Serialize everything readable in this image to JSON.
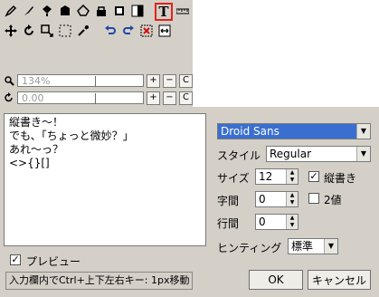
{
  "toolbar": {
    "icons_row1": [
      "pen-icon",
      "brush-icon",
      "fill-icon",
      "shape-icon",
      "polygon-icon",
      "lock-icon",
      "select-icon",
      "contrast-icon",
      "text-tool-icon",
      "ruler-icon"
    ],
    "icons_row2": [
      "move-icon",
      "rotate-icon",
      "resize-icon",
      "marquee-icon",
      "eyedropper-icon",
      "undo-icon",
      "redo-icon",
      "delete-icon",
      "flip-icon"
    ],
    "text_tool_glyph": "T"
  },
  "zoom": {
    "scale_value": "134%",
    "rotation_value": "0.00",
    "plus": "+",
    "minus": "−",
    "reset": "C"
  },
  "text_input": {
    "lines": [
      "縦書き～！",
      "でも、「ちょっと微妙？」",
      "あれ～っ？",
      "<>{}[]"
    ]
  },
  "font": {
    "family": "Droid Sans",
    "style_label": "スタイル",
    "style_value": "Regular",
    "size_label": "サイズ",
    "size_value": "12",
    "vertical_label": "縦書き",
    "vertical_checked": true,
    "letter_spacing_label": "字間",
    "letter_spacing_value": "0",
    "binary_label": "2値",
    "binary_checked": false,
    "line_spacing_label": "行間",
    "line_spacing_value": "0",
    "hinting_label": "ヒンティング",
    "hinting_value": "標準"
  },
  "preview": {
    "label": "プレビュー",
    "checked": true
  },
  "status_text": "入力欄内でCtrl+上下左右キー: 1px移動",
  "buttons": {
    "ok": "OK",
    "cancel": "キャンセル"
  },
  "colors": {
    "highlight": "#3a6fcf",
    "active_tool_border": "#e0241c",
    "panel_bg": "#d4d0c8"
  }
}
